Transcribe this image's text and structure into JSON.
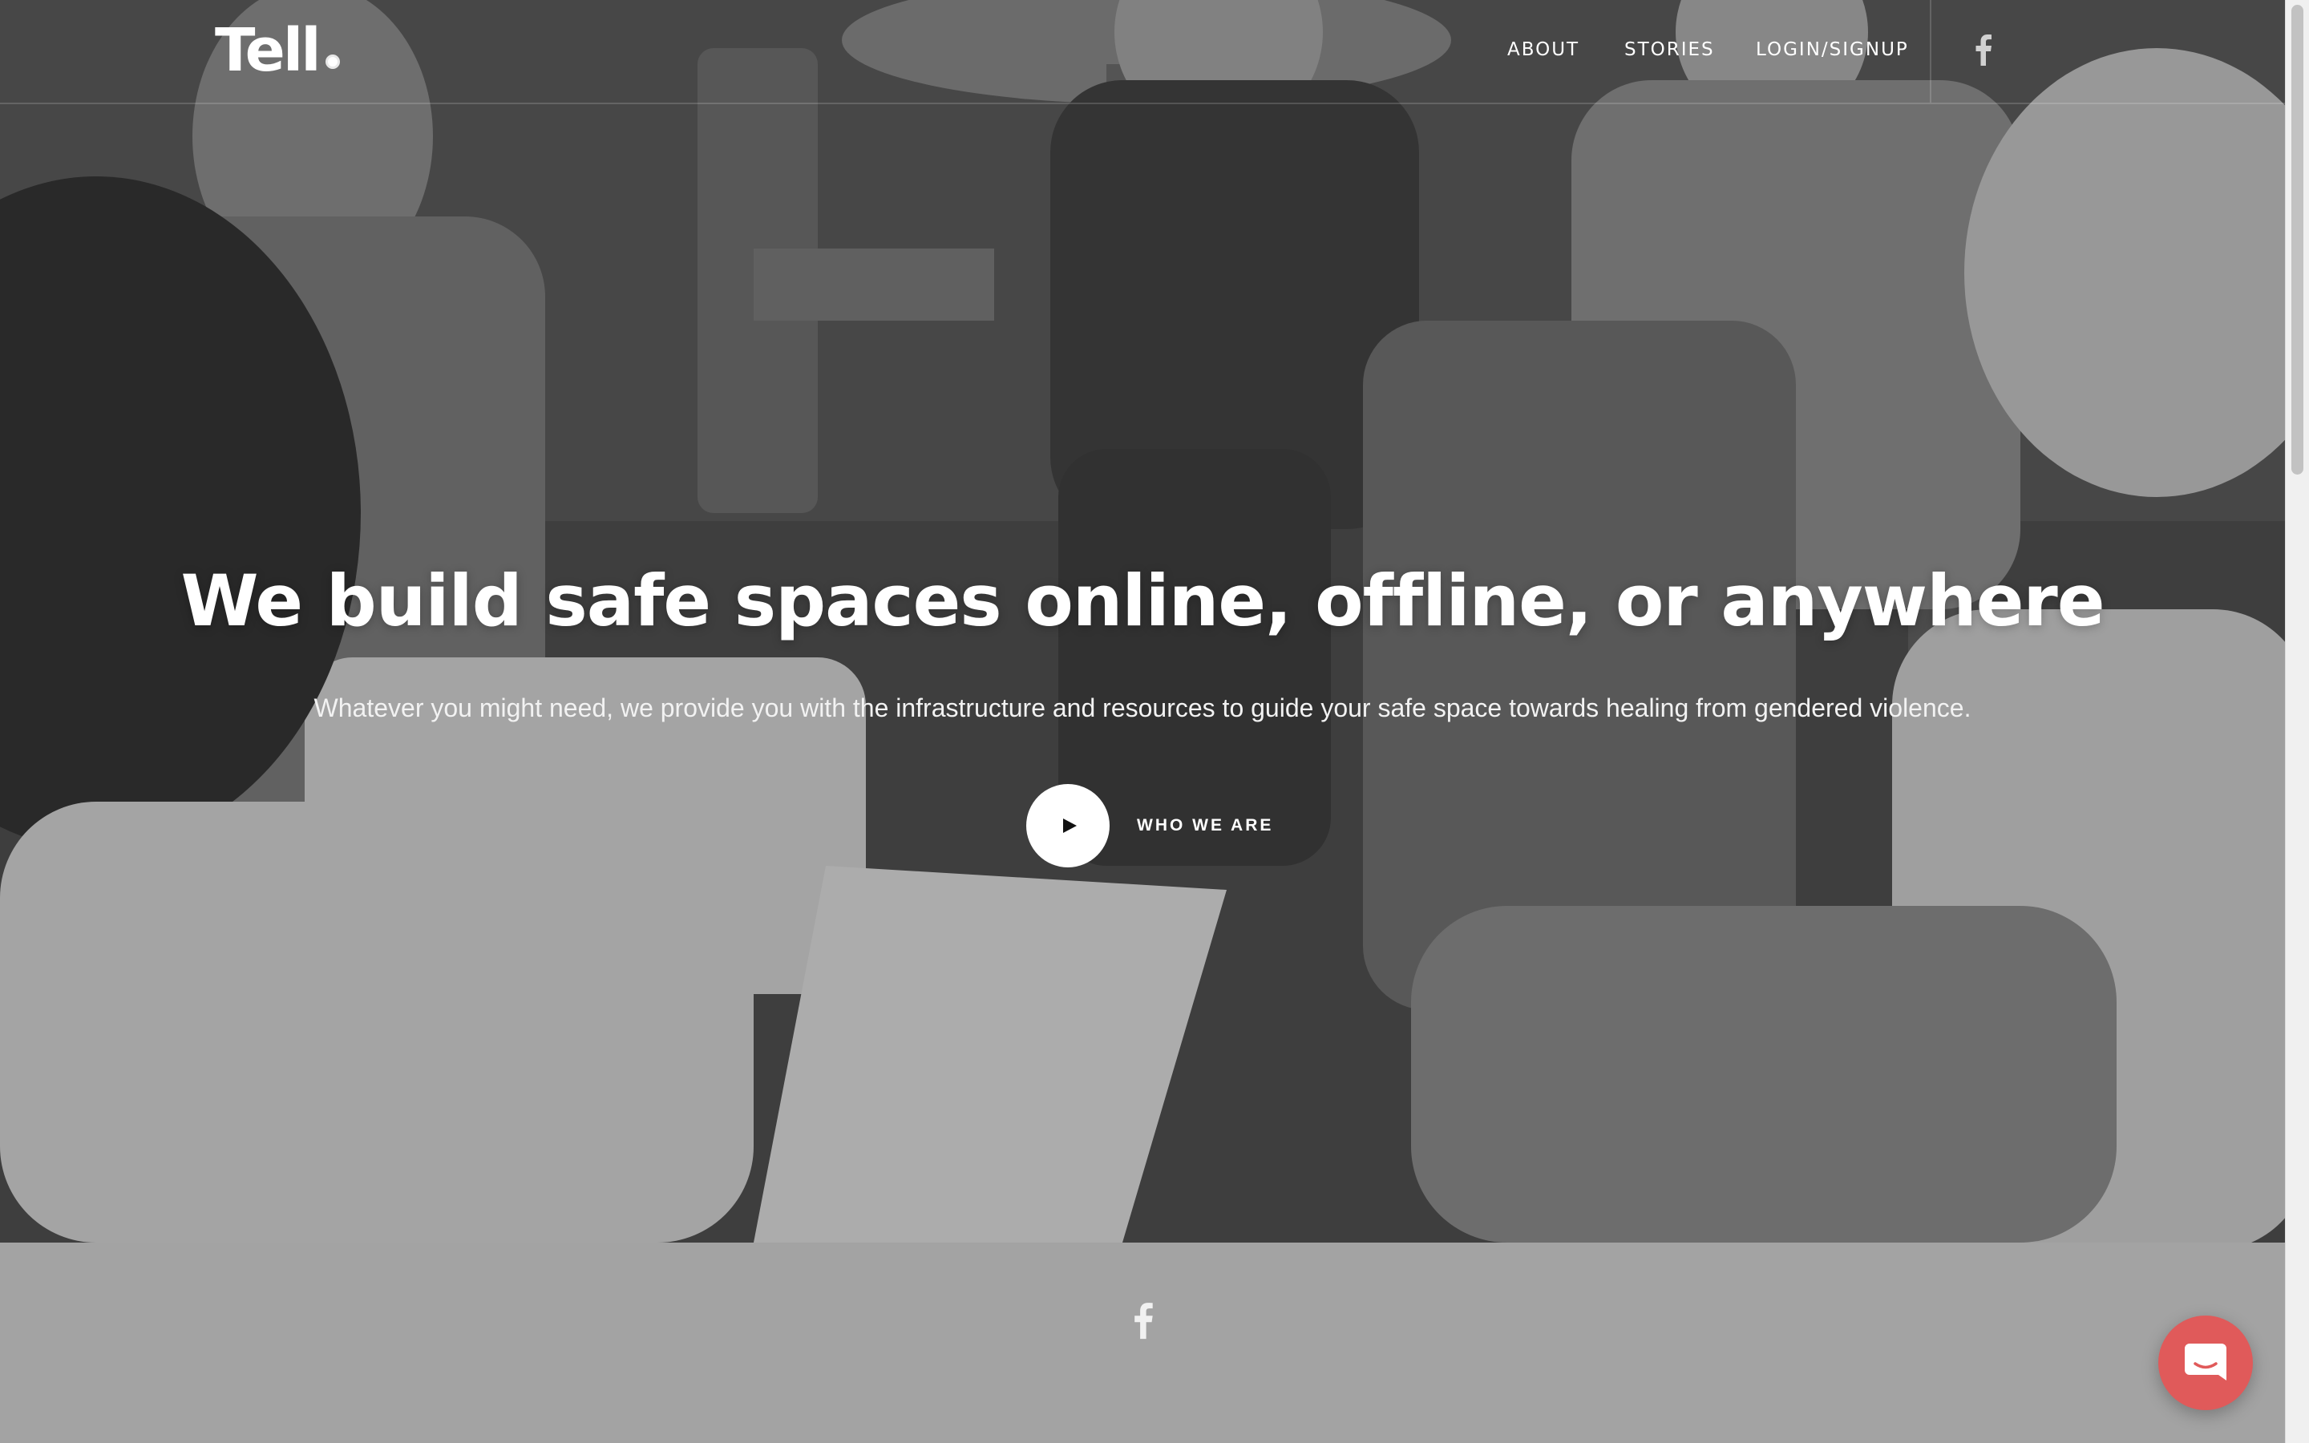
{
  "header": {
    "logo_text": "Tell",
    "nav": [
      {
        "label": "ABOUT"
      },
      {
        "label": "STORIES"
      },
      {
        "label": "LOGIN/SIGNUP"
      }
    ],
    "social_icon": "facebook-icon"
  },
  "hero": {
    "title": "We build safe spaces online, offline, or anywhere",
    "subtitle": "Whatever you might need, we provide you with the infrastructure and resources to guide your safe space towards healing from gendered violence.",
    "cta_label": "WHO WE ARE",
    "cta_icon": "play-icon",
    "background": "grayscale photo of people seated in a circle"
  },
  "footer": {
    "social_icon": "facebook-icon"
  },
  "chat": {
    "icon": "chat-icon",
    "color": "#e05a5a"
  },
  "colors": {
    "footer_bg": "#a3a3a3",
    "text": "#ffffff"
  }
}
